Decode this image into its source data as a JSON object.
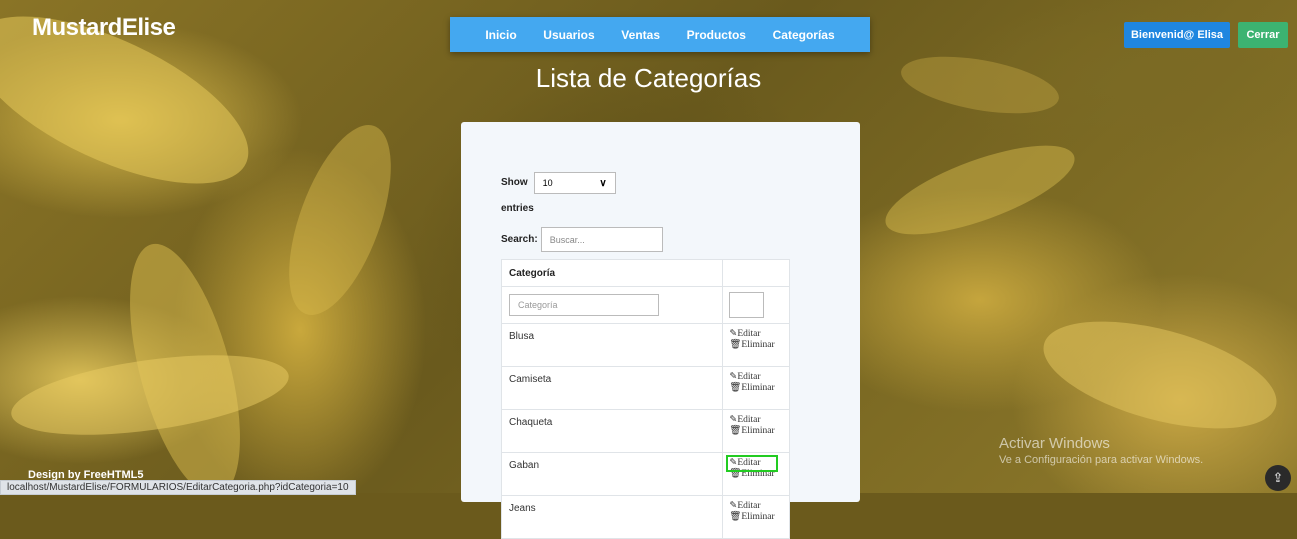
{
  "brand": "MustardElise",
  "nav": [
    "Inicio",
    "Usuarios",
    "Ventas",
    "Productos",
    "Categorías"
  ],
  "welcome_button": "Bienvenid@ Elisa",
  "logout_button": "Cerrar",
  "page_title": "Lista de Categorías",
  "table_controls": {
    "show_label": "Show",
    "entries_value": "10",
    "entries_label": "entries",
    "search_label": "Search:",
    "search_placeholder": "Buscar..."
  },
  "table": {
    "header": "Categoría",
    "filter_placeholder": "Categoría",
    "edit_label": "Editar",
    "delete_label": "Eliminar",
    "rows": [
      "Blusa",
      "Camiseta",
      "Chaqueta",
      "Gaban",
      "Jeans"
    ]
  },
  "footer": {
    "design_credit": "Design by FreeHTML5",
    "status_url": "localhost/MustardElise/FORMULARIOS/EditarCategoria.php?idCategoria=10"
  },
  "windows_watermark": {
    "title": "Activar Windows",
    "subtitle": "Ve a Configuración para activar Windows."
  },
  "colors": {
    "navbar": "#44a8f0",
    "welcome": "#1f86e0",
    "logout": "#3cb371",
    "highlight": "#22cc22"
  }
}
